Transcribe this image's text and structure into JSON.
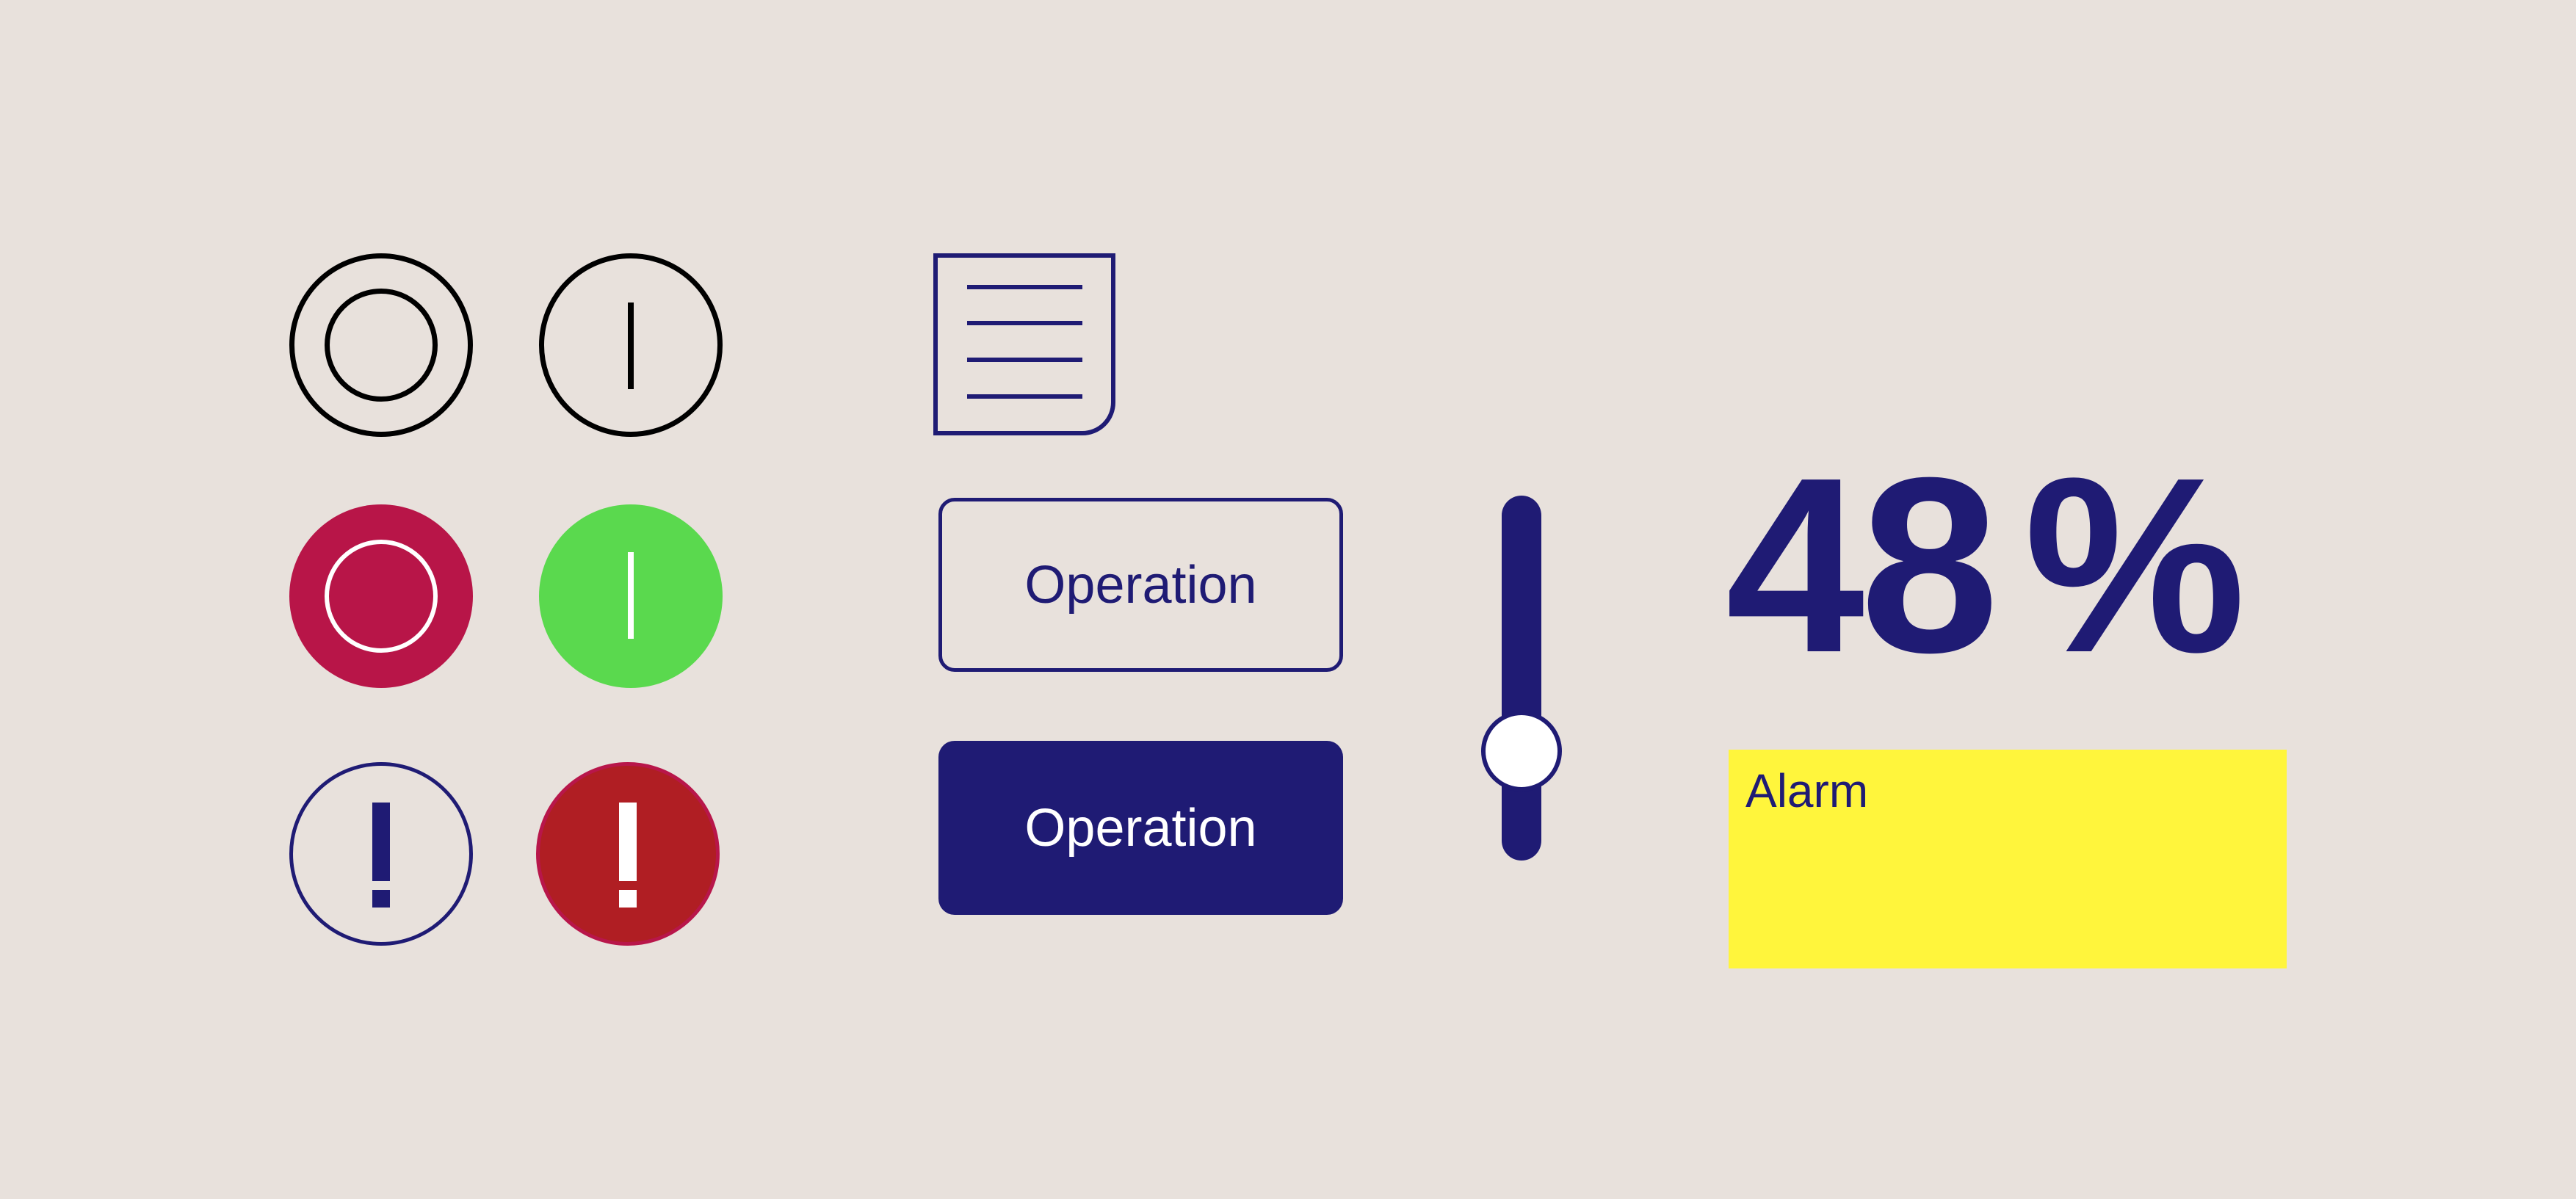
{
  "colors": {
    "background": "#E8E1DC",
    "navy": "#1F1B74",
    "stop_red": "#B81548",
    "start_green": "#5AD94E",
    "alarm_red": "#B01E23",
    "alarm_yellow": "#FFF53C",
    "outline_black": "#000000",
    "white": "#FFFFFF"
  },
  "status_buttons": [
    {
      "name": "off-outline",
      "icon": "power-off-icon",
      "style": "outline",
      "color": "#000000"
    },
    {
      "name": "on-outline",
      "icon": "power-on-icon",
      "style": "outline",
      "color": "#000000"
    },
    {
      "name": "stop-filled",
      "icon": "power-off-icon",
      "style": "filled",
      "color": "#B81548"
    },
    {
      "name": "start-filled",
      "icon": "power-on-icon",
      "style": "filled",
      "color": "#5AD94E"
    },
    {
      "name": "warning-outline",
      "icon": "exclamation-icon",
      "style": "outline",
      "color": "#1F1B74"
    },
    {
      "name": "alarm-filled",
      "icon": "exclamation-icon",
      "style": "filled",
      "color": "#B01E23"
    }
  ],
  "document_icon": {
    "icon": "document-list-icon",
    "lines": 4
  },
  "buttons": {
    "outline_label": "Operation",
    "filled_label": "Operation"
  },
  "slider": {
    "orientation": "vertical",
    "value_fraction": 0.3
  },
  "readout": {
    "value": "48",
    "unit": "%"
  },
  "alarm": {
    "label": "Alarm"
  }
}
